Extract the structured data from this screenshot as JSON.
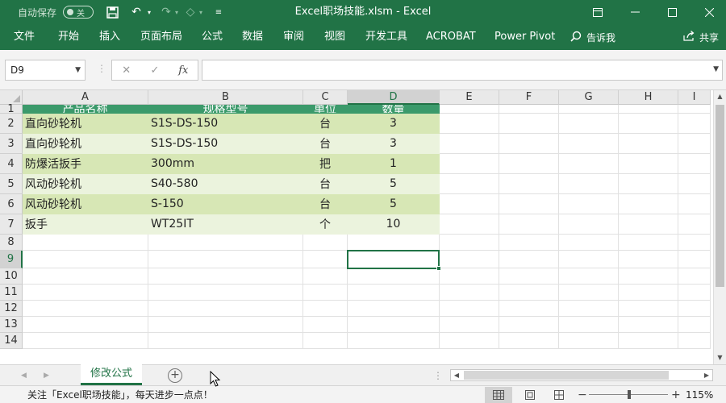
{
  "titlebar": {
    "autosave_label": "自动保存",
    "autosave_state": "关",
    "title": "Excel职场技能.xlsm  -  Excel"
  },
  "ribbon": {
    "tabs": [
      "文件",
      "开始",
      "插入",
      "页面布局",
      "公式",
      "数据",
      "审阅",
      "视图",
      "开发工具",
      "ACROBAT",
      "Power Pivot"
    ],
    "tell_me": "告诉我",
    "share": "共享"
  },
  "formula_bar": {
    "name_box": "D9",
    "formula": ""
  },
  "sheet": {
    "columns": [
      "A",
      "B",
      "C",
      "D",
      "E",
      "F",
      "G",
      "H",
      "I"
    ],
    "rows": [
      "1",
      "2",
      "3",
      "4",
      "5",
      "6",
      "7",
      "8",
      "9",
      "10",
      "11",
      "12",
      "13",
      "14"
    ],
    "selected_column": "D",
    "selected_row": "9",
    "table_headers": [
      "产品名称",
      "规格型号",
      "单位",
      "数量"
    ],
    "table_rows": [
      [
        "直向砂轮机",
        "S1S-DS-150",
        "台",
        "3"
      ],
      [
        "直向砂轮机",
        "S1S-DS-150",
        "台",
        "3"
      ],
      [
        "防爆活扳手",
        "300mm",
        "把",
        "1"
      ],
      [
        "风动砂轮机",
        "S40-580",
        "台",
        "5"
      ],
      [
        "风动砂轮机",
        "S-150",
        "台",
        "5"
      ],
      [
        "扳手",
        "WT25IT",
        "个",
        "10"
      ]
    ]
  },
  "sheet_tabs": {
    "active_tab": "修改公式"
  },
  "status_bar": {
    "message": "关注「Excel职场技能」，每天进步一点点！",
    "zoom": "115%"
  },
  "colors": {
    "accent": "#217346",
    "table_header": "#3b9a6b",
    "band_dark": "#d7e7b5",
    "band_light": "#ebf3dd"
  }
}
